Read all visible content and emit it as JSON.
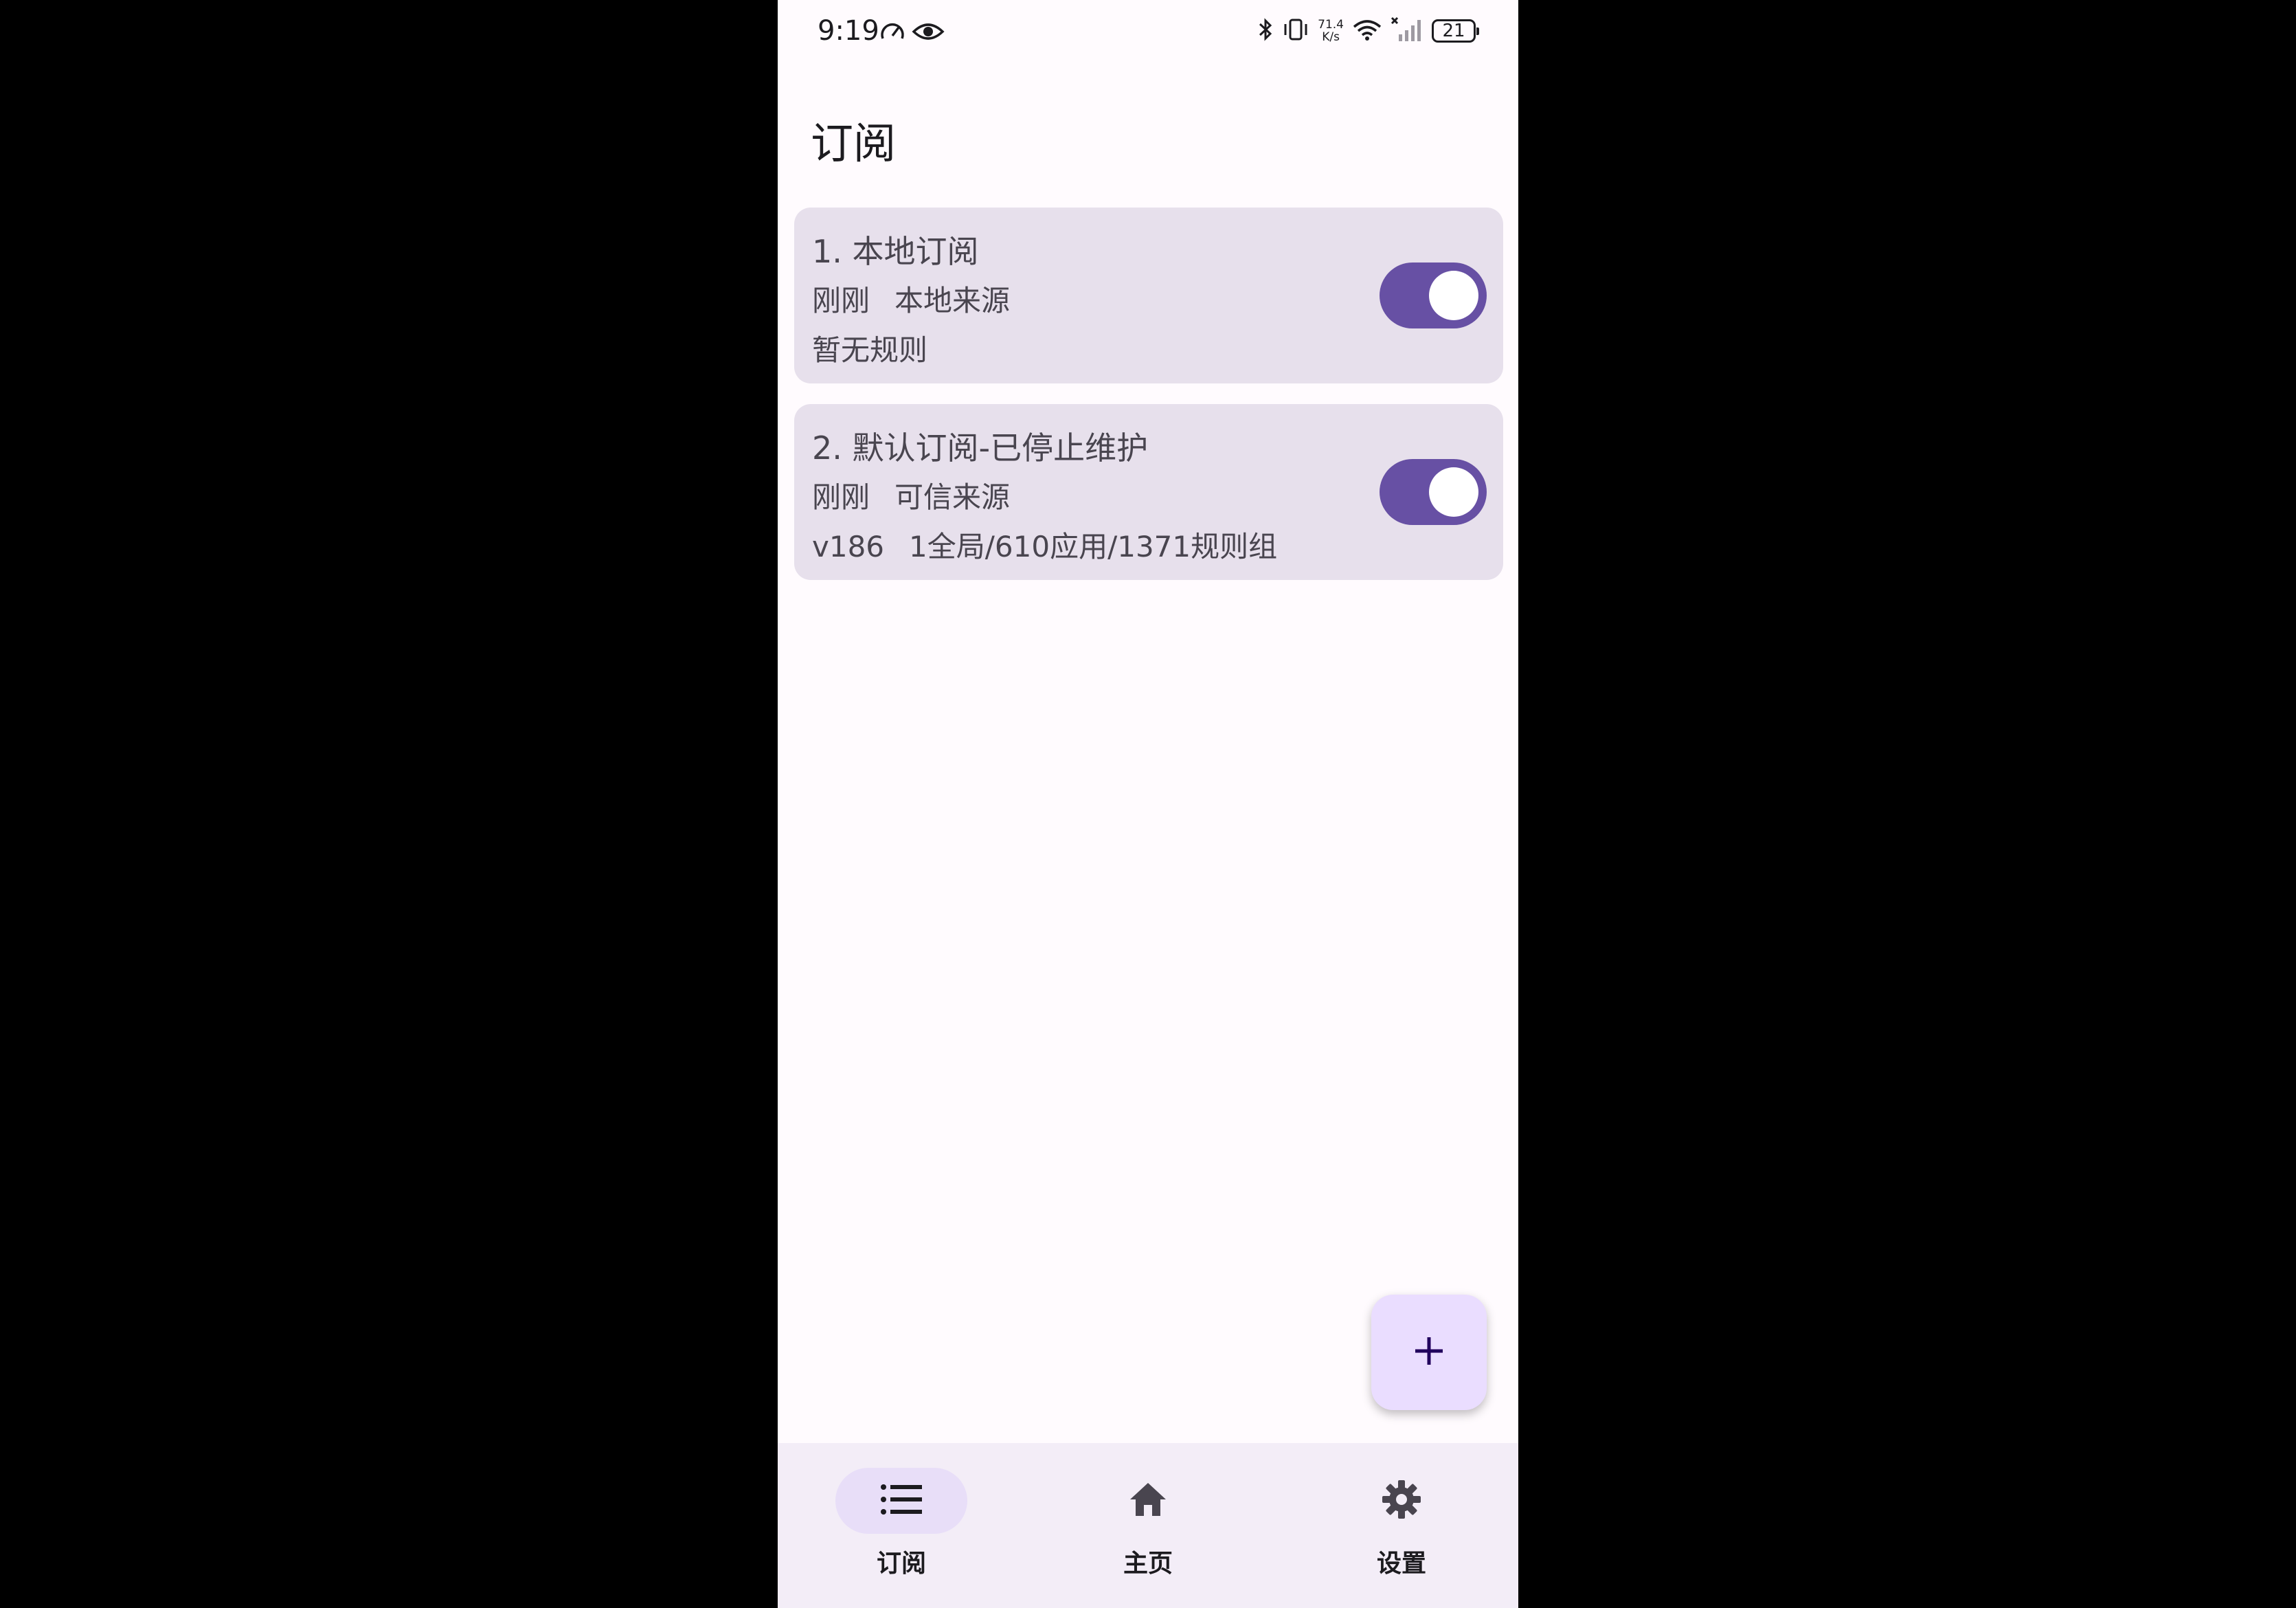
{
  "status_bar": {
    "time": "9:19",
    "net_speed_value": "71.4",
    "net_speed_unit": "K/s",
    "battery": "21",
    "icons": [
      "speed-gauge-icon",
      "eye-icon",
      "bluetooth-icon",
      "vibrate-icon",
      "wifi-icon",
      "no-signal-icon",
      "battery-icon"
    ]
  },
  "app_bar": {
    "title": "订阅"
  },
  "subscriptions": [
    {
      "title": "1. 本地订阅",
      "time": "刚刚",
      "source": "本地来源",
      "detail_a": "暂无规则",
      "detail_b": "",
      "enabled": true
    },
    {
      "title": "2. 默认订阅-已停止维护",
      "time": "刚刚",
      "source": "可信来源",
      "detail_a": "v186",
      "detail_b": "1全局/610应用/1371规则组",
      "enabled": true
    }
  ],
  "fab": {
    "icon": "plus-icon"
  },
  "bottom_nav": {
    "items": [
      {
        "label": "订阅",
        "icon": "list-icon",
        "active": true
      },
      {
        "label": "主页",
        "icon": "home-icon",
        "active": false
      },
      {
        "label": "设置",
        "icon": "gear-icon",
        "active": false
      }
    ]
  },
  "colors": {
    "primary": "#6750A4",
    "card_bg": "#E7E0EC",
    "fab_bg": "#EADDFF",
    "nav_bg": "#F3EDF7",
    "nav_indicator": "#E8DEF8",
    "surface": "#FFFBFE"
  }
}
